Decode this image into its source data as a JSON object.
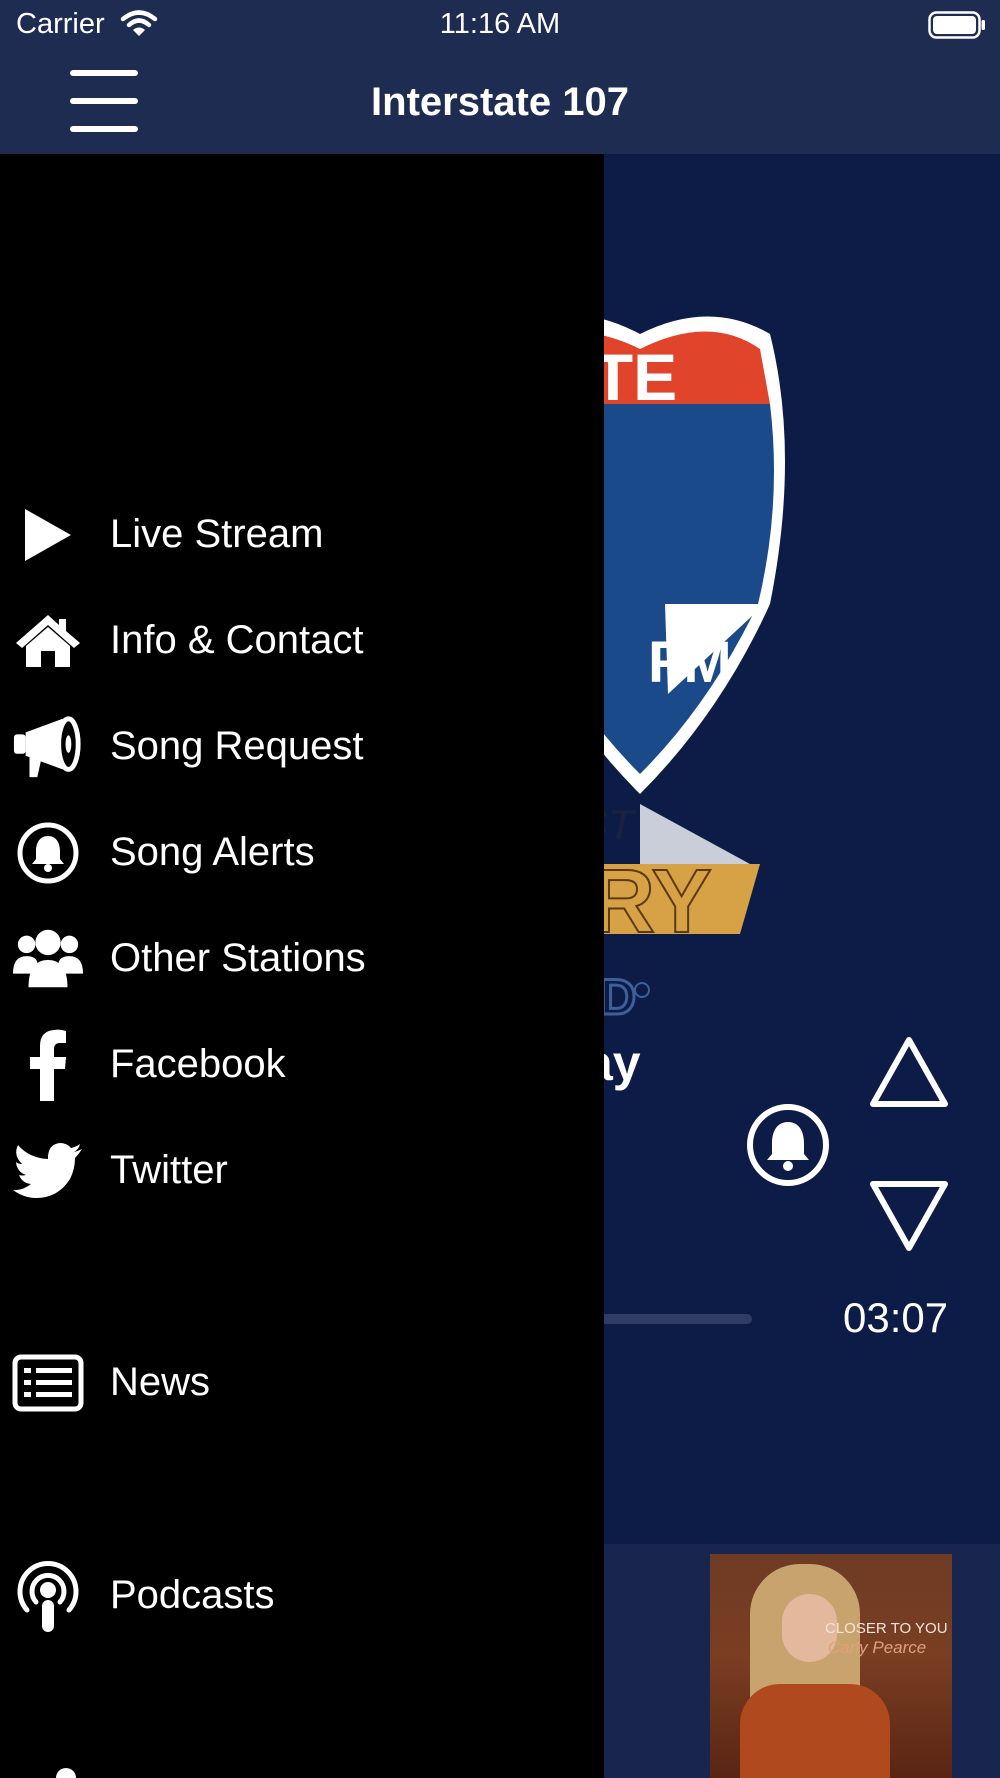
{
  "status_bar": {
    "carrier": "Carrier",
    "time": "11:16 AM"
  },
  "nav": {
    "title": "Interstate 107"
  },
  "menu": {
    "items": [
      {
        "label": "Live Stream",
        "icon": "play-icon"
      },
      {
        "label": "Info & Contact",
        "icon": "home-icon"
      },
      {
        "label": "Song Request",
        "icon": "megaphone-icon"
      },
      {
        "label": "Song Alerts",
        "icon": "bell-icon"
      },
      {
        "label": "Other Stations",
        "icon": "users-icon"
      },
      {
        "label": "Facebook",
        "icon": "facebook-icon"
      },
      {
        "label": "Twitter",
        "icon": "twitter-icon"
      },
      {
        "label": "News",
        "icon": "news-icon"
      },
      {
        "label": "Podcasts",
        "icon": "podcast-icon"
      }
    ]
  },
  "player": {
    "song_title_fragment": "ay",
    "time_remaining": "03:07",
    "logo_text": {
      "banner": "ATE",
      "suffix": "FM",
      "tagline": "ST",
      "genre": "RY",
      "trademark": "D"
    },
    "album": {
      "title": "CLOSER TO YOU",
      "artist": "Carly Pearce"
    }
  },
  "colors": {
    "background": "#0d1c47",
    "nav_bar": "#1f2c52",
    "drawer": "#000000",
    "logo_red": "#e0452c",
    "logo_blue": "#1a4a8a",
    "logo_gold": "#d7a146"
  }
}
